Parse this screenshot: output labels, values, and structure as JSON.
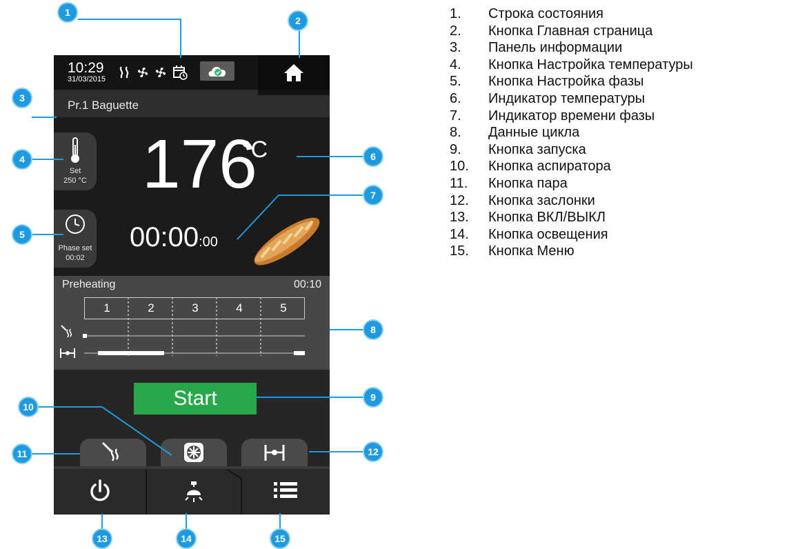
{
  "screen": {
    "status_bar": {
      "time": "10:29",
      "date": "31/03/2015",
      "icons": [
        "steam-icon",
        "fan-icon",
        "fan-icon",
        "calendar-clock-icon",
        "cloud-check-icon"
      ]
    },
    "home_button": {
      "icon": "home-icon"
    },
    "info_panel": {
      "program_name": "Pr.1 Baguette"
    },
    "temperature_button": {
      "icon": "thermometer-icon",
      "label": "Set",
      "value": "250 °C"
    },
    "phase_button": {
      "icon": "clock-icon",
      "label": "Phase set",
      "value": "00:02"
    },
    "temperature_display": {
      "value": "176",
      "unit": "°C"
    },
    "phase_time": {
      "main": "00:00",
      "seconds": ":00"
    },
    "product_image": {
      "icon": "baguette-icon"
    },
    "cycle": {
      "label": "Preheating",
      "time": "00:10",
      "phases": [
        "1",
        "2",
        "3",
        "4",
        "5"
      ],
      "row_icons": [
        "steam-icon",
        "damper-icon"
      ]
    },
    "start_button": {
      "label": "Start",
      "color": "#27a84a"
    },
    "tabs": [
      {
        "name": "steam",
        "icon": "steam-icon"
      },
      {
        "name": "extractor",
        "icon": "fan-icon"
      },
      {
        "name": "damper",
        "icon": "damper-icon"
      }
    ],
    "bottom_bar": [
      {
        "name": "power",
        "icon": "power-icon"
      },
      {
        "name": "light",
        "icon": "lamp-icon"
      },
      {
        "name": "menu",
        "icon": "menu-icon"
      }
    ]
  },
  "callouts": [
    "1",
    "2",
    "3",
    "4",
    "5",
    "6",
    "7",
    "8",
    "9",
    "10",
    "11",
    "12",
    "13",
    "14",
    "15"
  ],
  "legend": [
    {
      "num": "1.",
      "text": "Строка состояния"
    },
    {
      "num": "2.",
      "text": "Кнопка Главная страница"
    },
    {
      "num": "3.",
      "text": "Панель информации"
    },
    {
      "num": "4.",
      "text": "Кнопка Настройка температуры"
    },
    {
      "num": "5.",
      "text": "Кнопка Настройка фазы"
    },
    {
      "num": "6.",
      "text": "Индикатор температуры"
    },
    {
      "num": "7.",
      "text": "Индикатор времени фазы"
    },
    {
      "num": "8.",
      "text": "Данные цикла"
    },
    {
      "num": "9.",
      "text": "Кнопка запуска"
    },
    {
      "num": "10.",
      "text": "Кнопка аспиратора"
    },
    {
      "num": "11.",
      "text": "Кнопка пара"
    },
    {
      "num": "12.",
      "text": "Кнопка заслонки"
    },
    {
      "num": "13.",
      "text": "Кнопка ВКЛ/ВЫКЛ"
    },
    {
      "num": "14.",
      "text": "Кнопка освещения"
    },
    {
      "num": "15.",
      "text": "Кнопка Меню"
    }
  ],
  "colors": {
    "callout": "#1e9be0",
    "start": "#27a84a",
    "screen_background": "#1f1f1f"
  }
}
